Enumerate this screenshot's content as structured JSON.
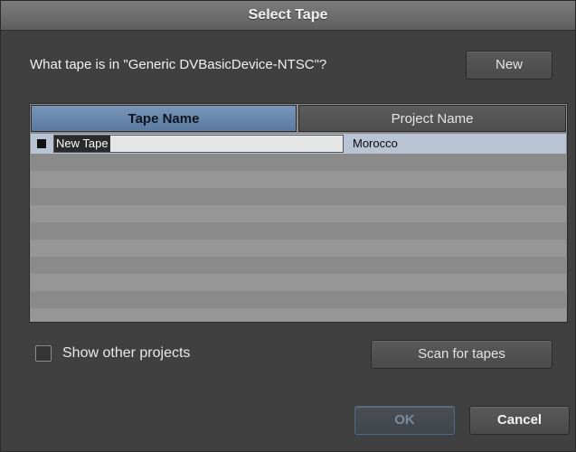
{
  "dialog": {
    "title": "Select Tape",
    "prompt": "What tape is in \"Generic DVBasicDevice-NTSC\"?",
    "new_label": "New"
  },
  "table": {
    "columns": [
      "Tape Name",
      "Project Name"
    ],
    "rows": [
      {
        "tape_name": "New Tape",
        "project_name": "Morocco",
        "selected": true
      }
    ]
  },
  "options": {
    "show_other_projects_label": "Show other projects",
    "show_other_projects_checked": false
  },
  "buttons": {
    "scan_label": "Scan for tapes",
    "ok_label": "OK",
    "cancel_label": "Cancel"
  },
  "colors": {
    "header_active": "#6a8ab0",
    "selected_row": "#b8c4d4",
    "dialog_bg": "#404040"
  }
}
